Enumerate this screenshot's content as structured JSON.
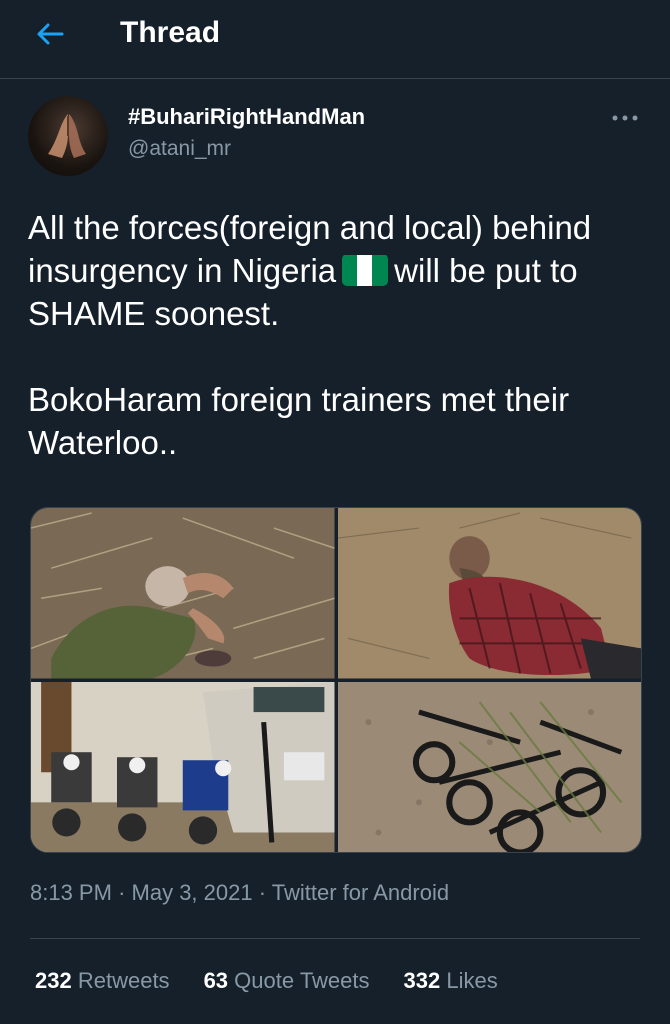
{
  "header": {
    "title": "Thread",
    "back_icon": "arrow-left-icon",
    "accent": "#1da1f2"
  },
  "author": {
    "display_name": "#BuhariRightHandMan",
    "handle": "@atani_mr",
    "avatar_icon": "praying-hands-icon",
    "more_icon": "more-horizontal-icon"
  },
  "tweet": {
    "line1_before_flag": "All the forces(foreign and local) behind insurgency in Nigeria",
    "flag_icon": "nigeria-flag-icon",
    "line1_after_flag": "will be put to SHAME soonest.",
    "paragraph2": "BokoHaram foreign trainers met their Waterloo..",
    "media": [
      {
        "name": "photo-1"
      },
      {
        "name": "photo-2"
      },
      {
        "name": "photo-3"
      },
      {
        "name": "photo-4"
      }
    ]
  },
  "meta": {
    "time": "8:13 PM",
    "date": "May 3, 2021",
    "separator": "·",
    "source": "Twitter for Android"
  },
  "stats": {
    "retweets_count": "232",
    "retweets_label": "Retweets",
    "quotes_count": "63",
    "quotes_label": "Quote Tweets",
    "likes_count": "332",
    "likes_label": "Likes"
  },
  "colors": {
    "background": "#15202b",
    "text": "#ffffff",
    "secondary": "#8899a6",
    "border": "#38444d",
    "flag_green": "#008751"
  }
}
